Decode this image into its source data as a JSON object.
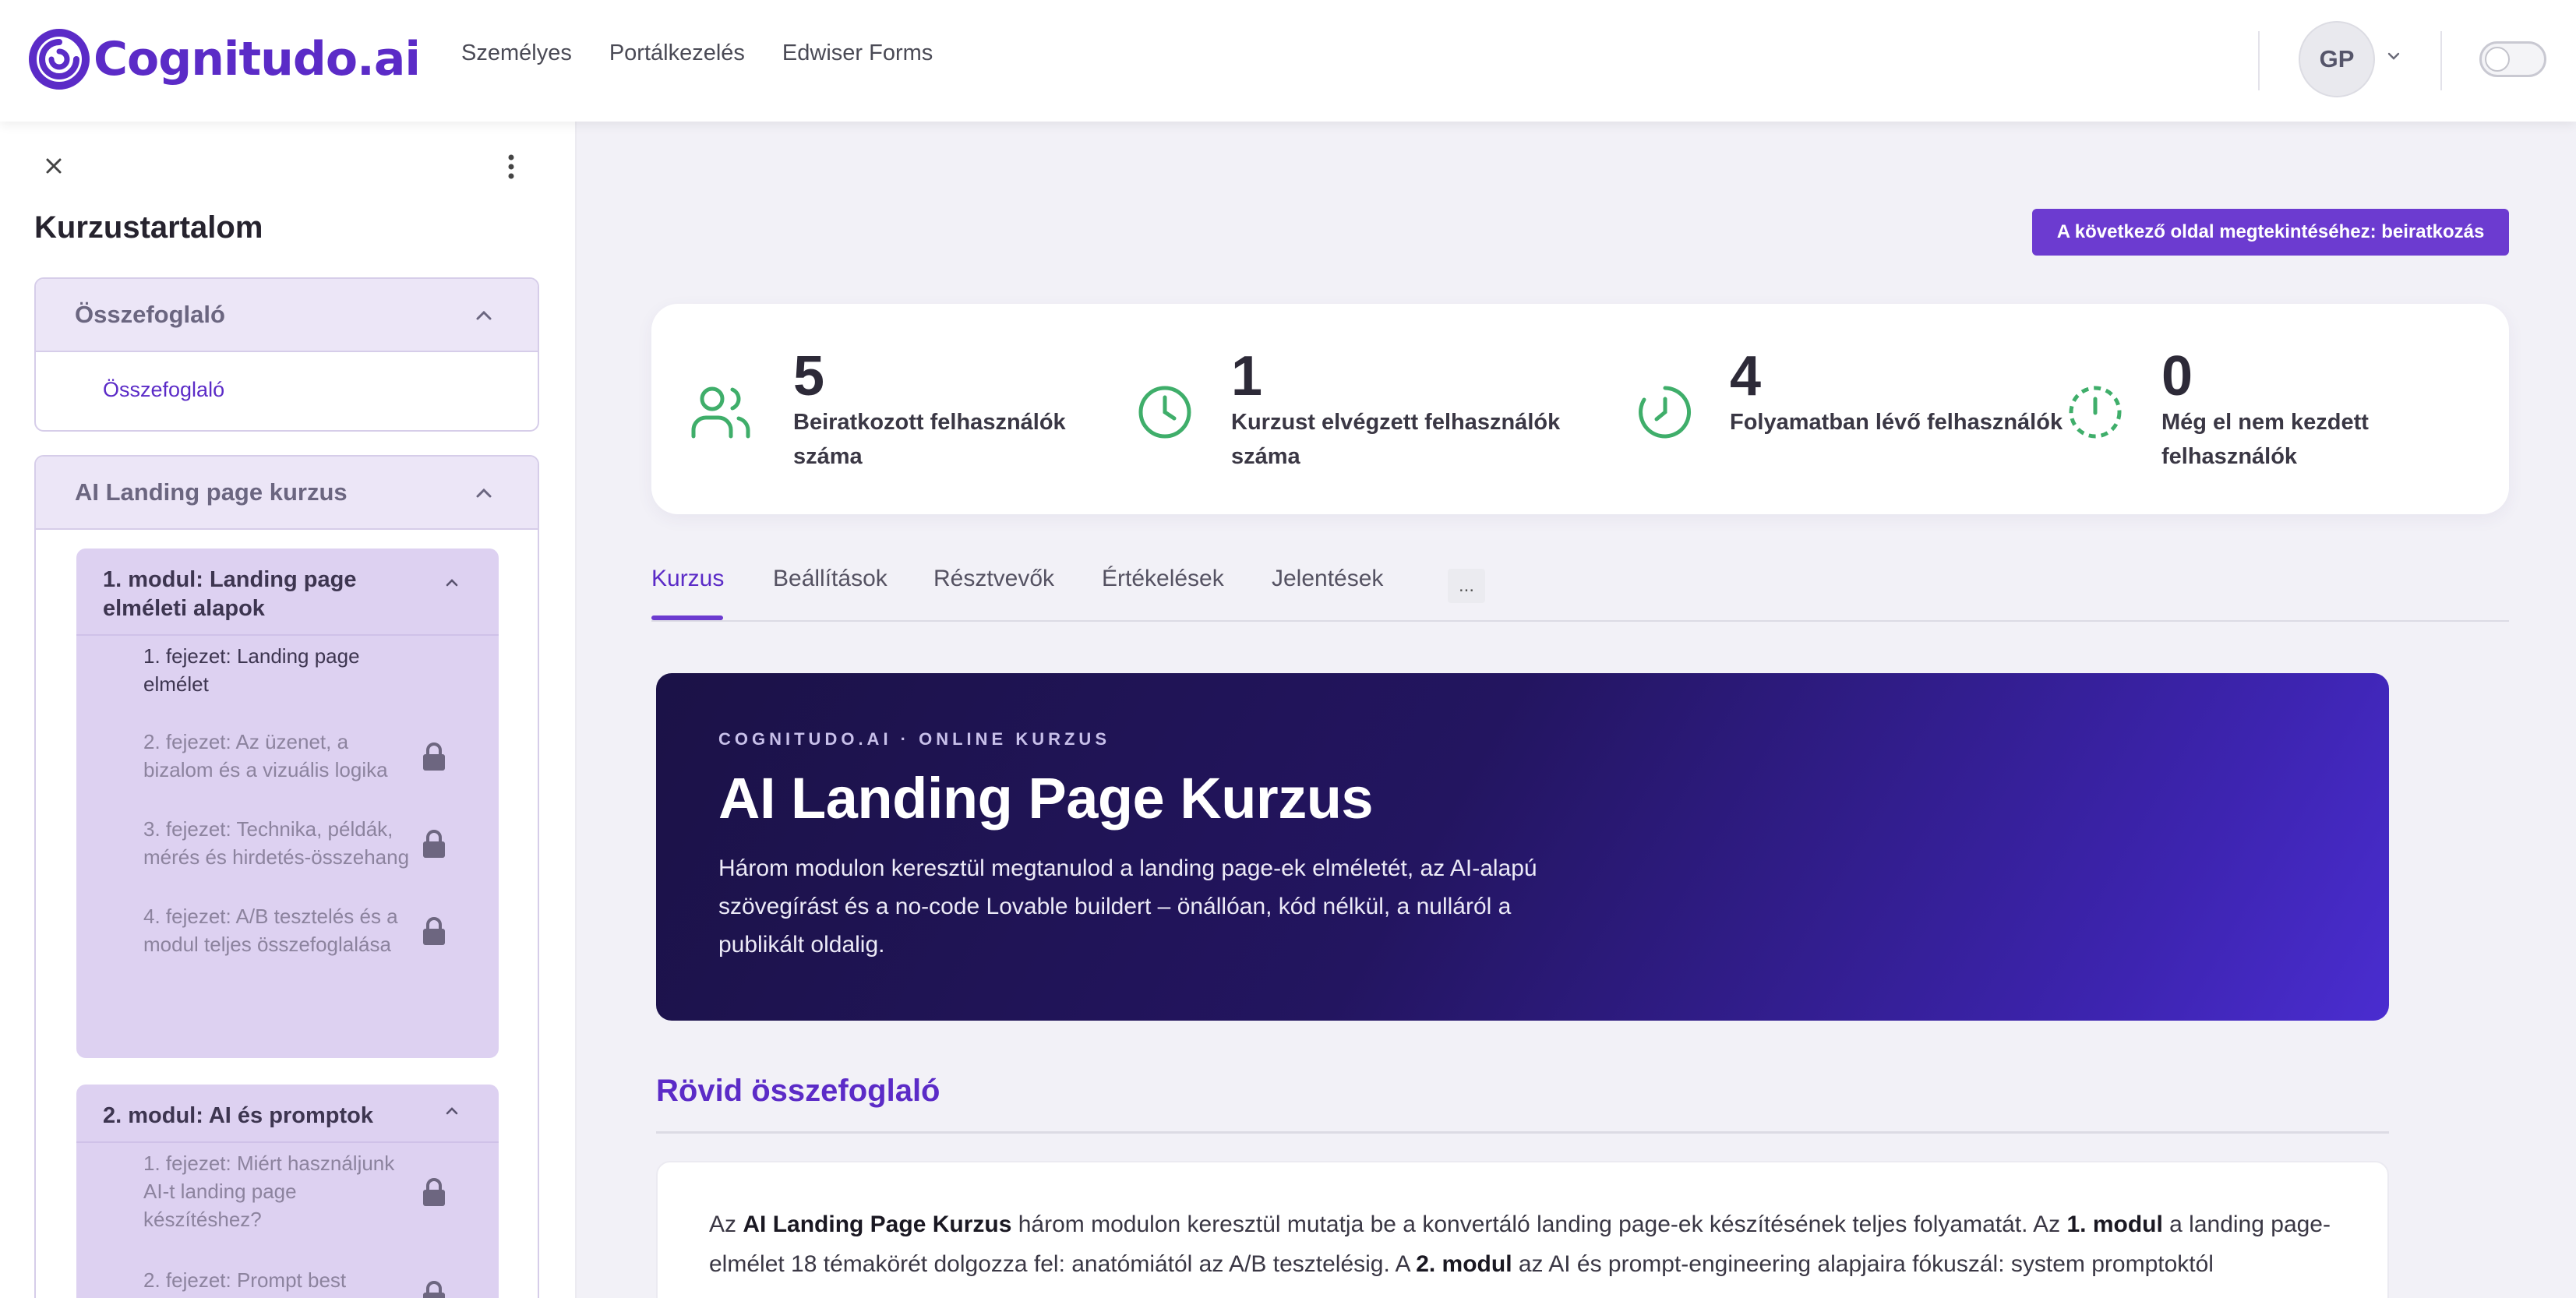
{
  "brand": {
    "name": "Cognitudo.ai",
    "accent": "#5b2bc7"
  },
  "nav": [
    "Személyes",
    "Portálkezelés",
    "Edwiser Forms"
  ],
  "user": {
    "initials": "GP"
  },
  "sidebar": {
    "title": "Kurzustartalom",
    "sections": [
      {
        "title": "Összefoglaló",
        "link": "Összefoglaló"
      },
      {
        "title": "AI Landing page kurzus",
        "modules": [
          {
            "title": "1. modul: Landing page elméleti alapok",
            "chapters": [
              {
                "label": "1. fejezet: Landing page elmélet",
                "locked": false
              },
              {
                "label": "2. fejezet: Az üzenet, a bizalom és a vizuális logika",
                "locked": true
              },
              {
                "label": "3. fejezet: Technika, példák, mérés és hirdetés-összehang",
                "locked": true
              },
              {
                "label": "4. fejezet: A/B tesztelés és a modul teljes összefoglalása",
                "locked": true
              }
            ]
          },
          {
            "title": "2. modul: AI és promptok",
            "chapters": [
              {
                "label": "1. fejezet: Miért használjunk AI-t landing page készítéshez?",
                "locked": true
              },
              {
                "label": "2. fejezet: Prompt best",
                "locked": true
              }
            ]
          }
        ]
      }
    ]
  },
  "enroll_button": "A következő oldal megtekintéséhez: beiratkozás",
  "stats": [
    {
      "value": "5",
      "label": "Beiratkozott felhasználók száma",
      "icon": "users-icon"
    },
    {
      "value": "1",
      "label": "Kurzust elvégzett felhasználók száma",
      "icon": "clock-icon"
    },
    {
      "value": "4",
      "label": "Folyamatban lévő felhasználók",
      "icon": "clock-progress-icon"
    },
    {
      "value": "0",
      "label": "Még el nem kezdett felhasználók",
      "icon": "clock-dashed-icon"
    }
  ],
  "tabs": [
    "Kurzus",
    "Beállítások",
    "Résztvevők",
    "Értékelések",
    "Jelentések"
  ],
  "tab_more": "...",
  "hero": {
    "kicker": "COGNITUDO.AI · ONLINE KURZUS",
    "title": "AI Landing Page Kurzus",
    "description": "Három modulon keresztül megtanulod a landing page-ek elméletét, az AI-alapú szövegírást és a no-code Lovable buildert – önállóan, kód nélkül, a nulláról a publikált oldalig."
  },
  "summary": {
    "title": "Rövid összefoglaló",
    "p1": "Az ",
    "b1": "AI Landing Page Kurzus",
    "p2": " három modulon keresztül mutatja be a konvertáló landing page-ek készítésének teljes folyamatát. Az ",
    "b2": "1. modul",
    "p3": " a landing page-elmélet 18 témakörét dolgozza fel: anatómiától az A/B tesztelésig. A ",
    "b3": "2. modul",
    "p4": " az AI és prompt-engineering alapjaira fókuszál: system promptoktól"
  },
  "colors": {
    "stat_icon": "#3fae6a",
    "hero_start": "#1b1247",
    "hero_end": "#4a2dd0",
    "module_bg": "#ddd1f1"
  }
}
